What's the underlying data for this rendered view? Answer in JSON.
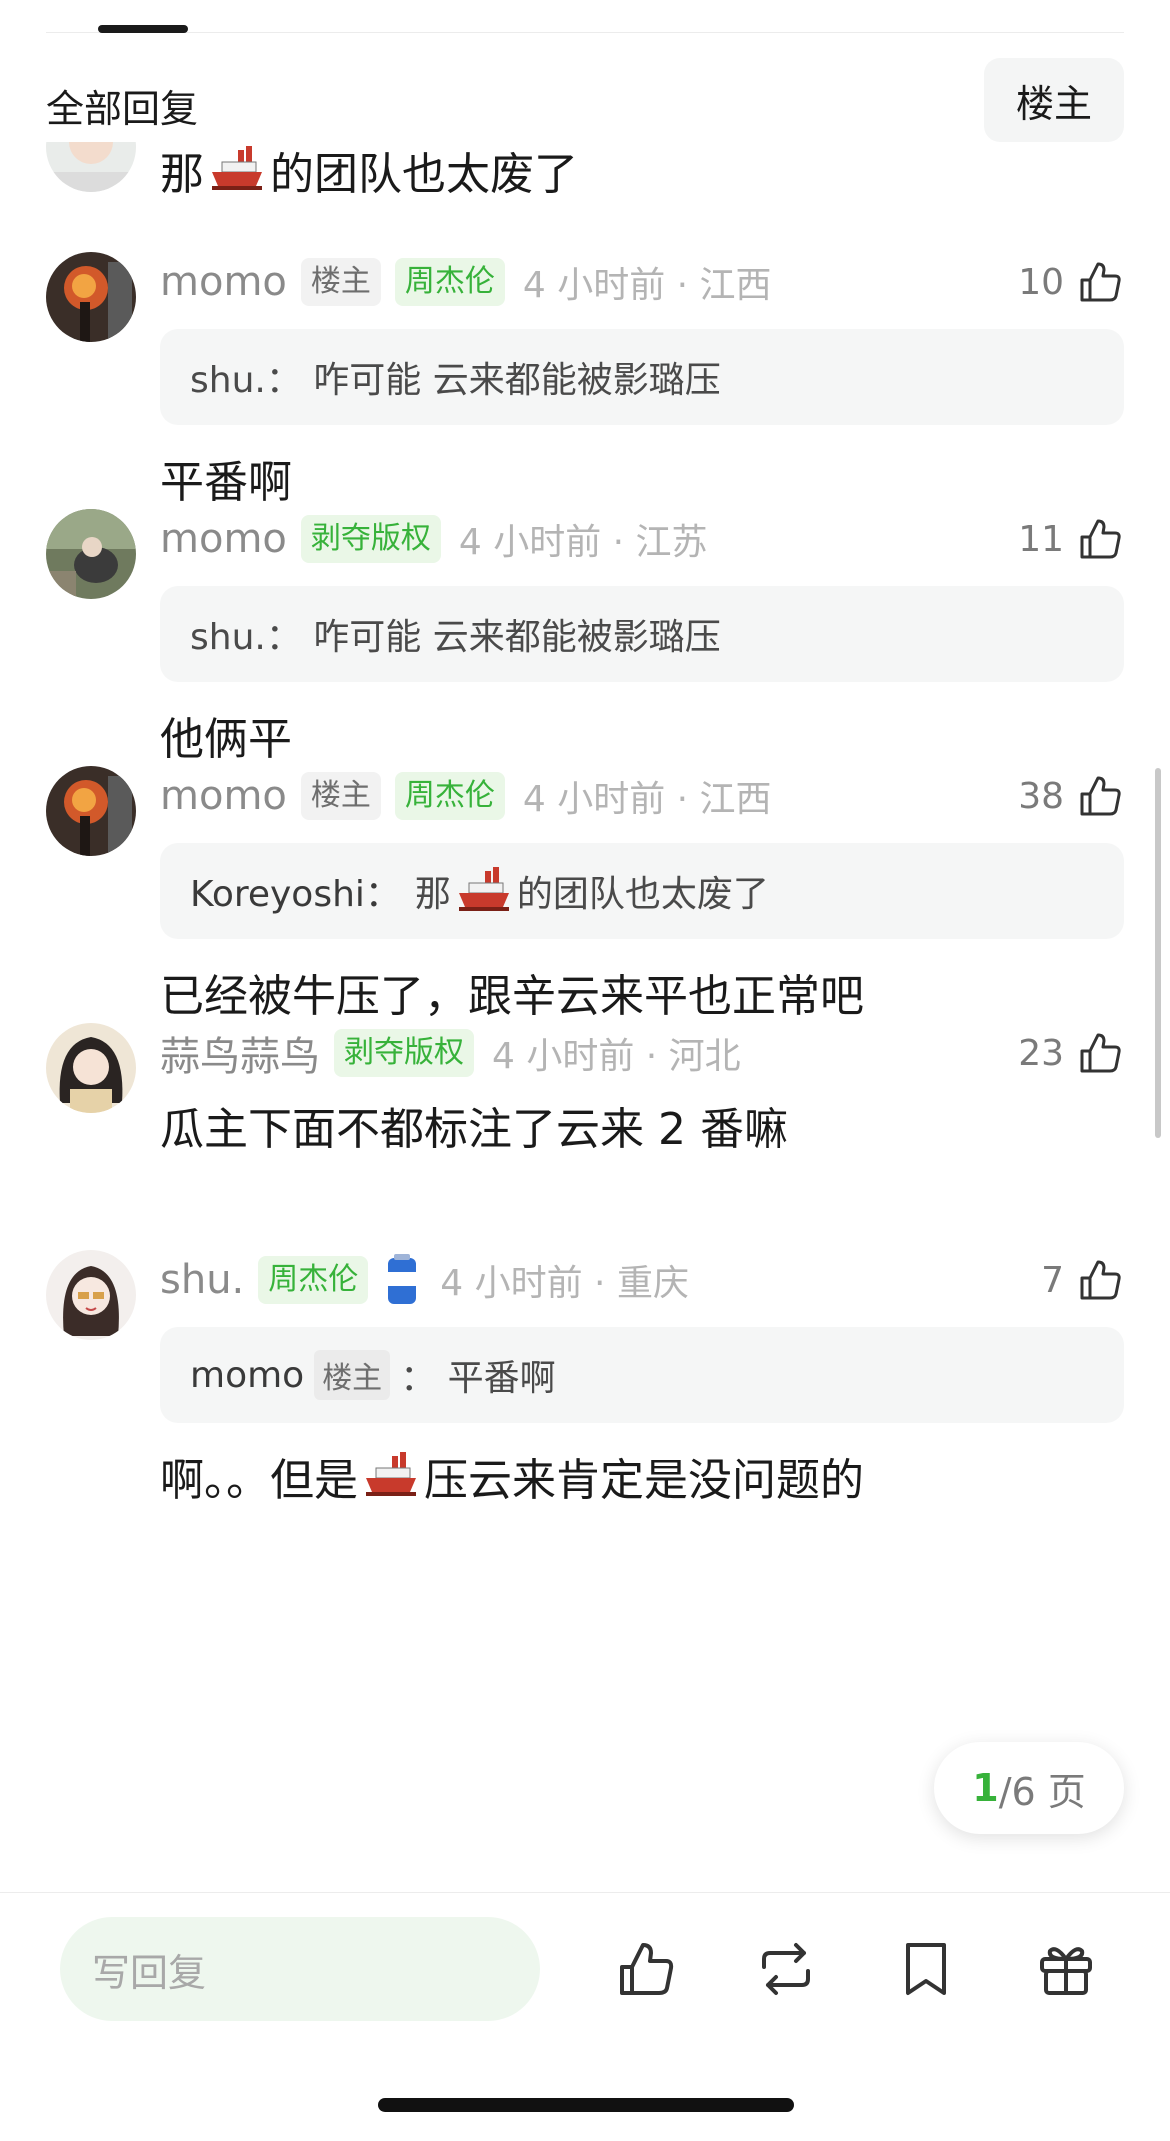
{
  "header": {
    "title": "全部回复",
    "op_button": "楼主"
  },
  "comments": [
    {
      "body_pre": "那",
      "body_post": "的团队也太废了"
    },
    {
      "name": "momo",
      "tag1": "楼主",
      "tag2": "周杰伦",
      "timeloc": "4 小时前 · 江西",
      "likes": "10",
      "quote": "shu.：  咋可能 云来都能被影璐压",
      "body": "平番啊"
    },
    {
      "name": "momo",
      "tag1": "剥夺版权",
      "timeloc": "4 小时前 · 江苏",
      "likes": "11",
      "quote": "shu.：  咋可能 云来都能被影璐压",
      "body": "他俩平"
    },
    {
      "name": "momo",
      "tag1": "楼主",
      "tag2": "周杰伦",
      "timeloc": "4 小时前 · 江西",
      "likes": "38",
      "quote_name": "Koreyoshi：",
      "quote_pre": "那",
      "quote_post": "的团队也太废了",
      "body": "已经被牛压了，跟辛云来平也正常吧"
    },
    {
      "name": "蒜鸟蒜鸟",
      "tag1": "剥夺版权",
      "timeloc": "4 小时前 · 河北",
      "likes": "23",
      "body": "瓜主下面不都标注了云来 2 番嘛"
    },
    {
      "name": "shu.",
      "tag1": "周杰伦",
      "timeloc": "4 小时前 · 重庆",
      "likes": "7",
      "quote_name": "momo",
      "quote_tag": "楼主",
      "quote_text": "：  平番啊",
      "body_pre": "啊。。但是",
      "body_post": "压云来肯定是没问题的"
    }
  ],
  "pager": {
    "current": "1",
    "rest": "/6 页"
  },
  "bottom": {
    "placeholder": "写回复"
  },
  "colors": {
    "accent_green": "#37b23a",
    "tag_green_bg": "#eaf7e7"
  }
}
